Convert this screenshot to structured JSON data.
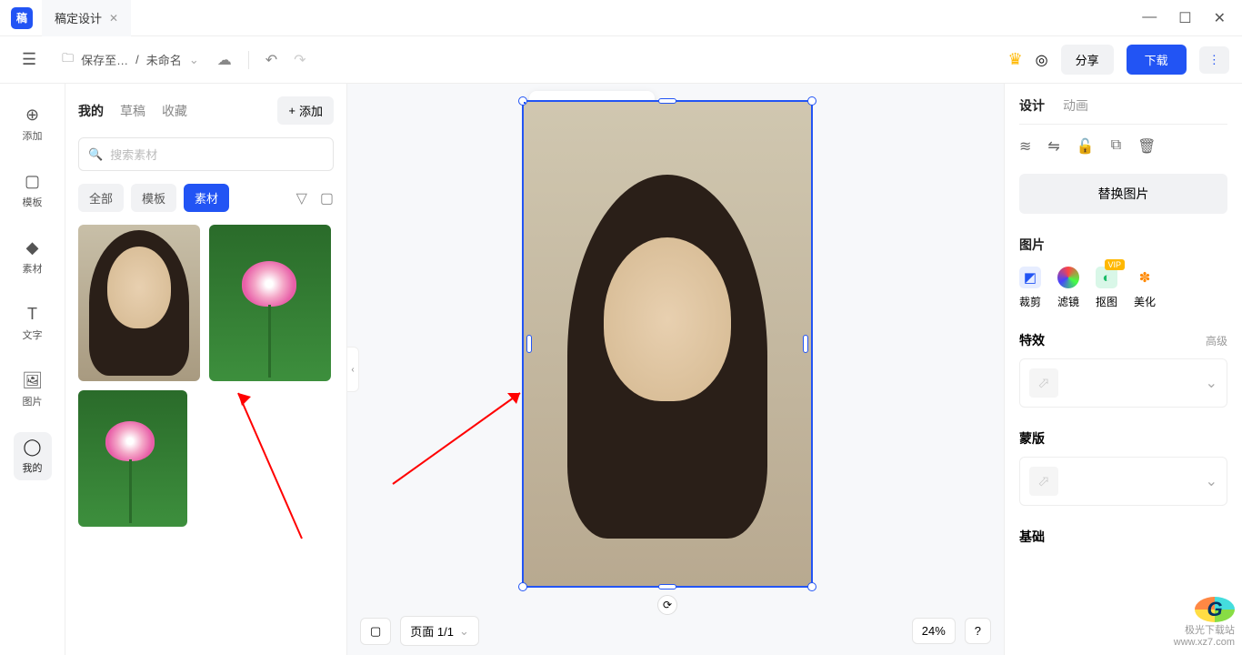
{
  "titlebar": {
    "logo": "稿",
    "tab": "稿定设计"
  },
  "toolbar": {
    "save_label": "保存至…",
    "filename": "未命名",
    "share": "分享",
    "download": "下载"
  },
  "nav": {
    "items": [
      {
        "icon": "⊕",
        "label": "添加"
      },
      {
        "icon": "▢",
        "label": "模板"
      },
      {
        "icon": "◆",
        "label": "素材"
      },
      {
        "icon": "T",
        "label": "文字"
      },
      {
        "icon": "🖼",
        "label": "图片"
      },
      {
        "icon": "◯",
        "label": "我的"
      }
    ]
  },
  "asset": {
    "tabs": [
      "我的",
      "草稿",
      "收藏"
    ],
    "add": "添加",
    "search_placeholder": "搜索素材",
    "filters": [
      "全部",
      "模板",
      "素材"
    ]
  },
  "canvas": {
    "page_label": "页面 1/1",
    "zoom": "24%"
  },
  "right": {
    "tabs": [
      "设计",
      "动画"
    ],
    "replace": "替换图片",
    "section_image": "图片",
    "tools": [
      {
        "label": "裁剪",
        "color": "#2254f4",
        "glyph": "◩"
      },
      {
        "label": "滤镜",
        "color": "#ff4d4d",
        "glyph": "●"
      },
      {
        "label": "抠图",
        "color": "#1abc68",
        "glyph": "◐",
        "vip": "VIP"
      },
      {
        "label": "美化",
        "color": "#ff8800",
        "glyph": "✽"
      }
    ],
    "section_fx": "特效",
    "advanced": "高级",
    "section_mask": "蒙版",
    "section_basic": "基础"
  },
  "watermark": {
    "site": "极光下载站",
    "url": "www.xz7.com"
  }
}
